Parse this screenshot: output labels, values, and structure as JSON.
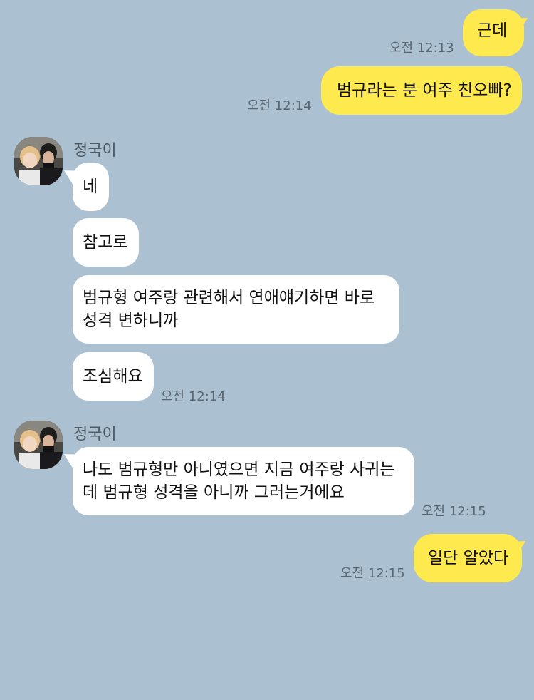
{
  "messages": [
    {
      "from": "me",
      "text": "근데",
      "time": "오전 12:13"
    },
    {
      "from": "me",
      "text": "범규라는 분 여주 친오빠?",
      "time": "오전 12:14"
    },
    {
      "from": "them",
      "sender": "정국이",
      "text": "네"
    },
    {
      "from": "them",
      "text": "참고로"
    },
    {
      "from": "them",
      "text": "범규형 여주랑 관련해서 연애얘기하면 바로 성격 변하니까"
    },
    {
      "from": "them",
      "text": "조심해요",
      "time": "오전 12:14"
    },
    {
      "from": "them",
      "sender": "정국이",
      "text": "나도 범규형만 아니였으면 지금 여주랑 사귀는데 범규형 성격을 아니까 그러는거에요",
      "time": "오전 12:15"
    },
    {
      "from": "me",
      "text": "일단 알았다",
      "time": "오전 12:15"
    }
  ],
  "colors": {
    "background": "#abc1d1",
    "my_bubble": "#fee94f",
    "their_bubble": "#ffffff",
    "timestamp": "#5a6772"
  },
  "icons": {
    "avatar": "profile-photo"
  }
}
